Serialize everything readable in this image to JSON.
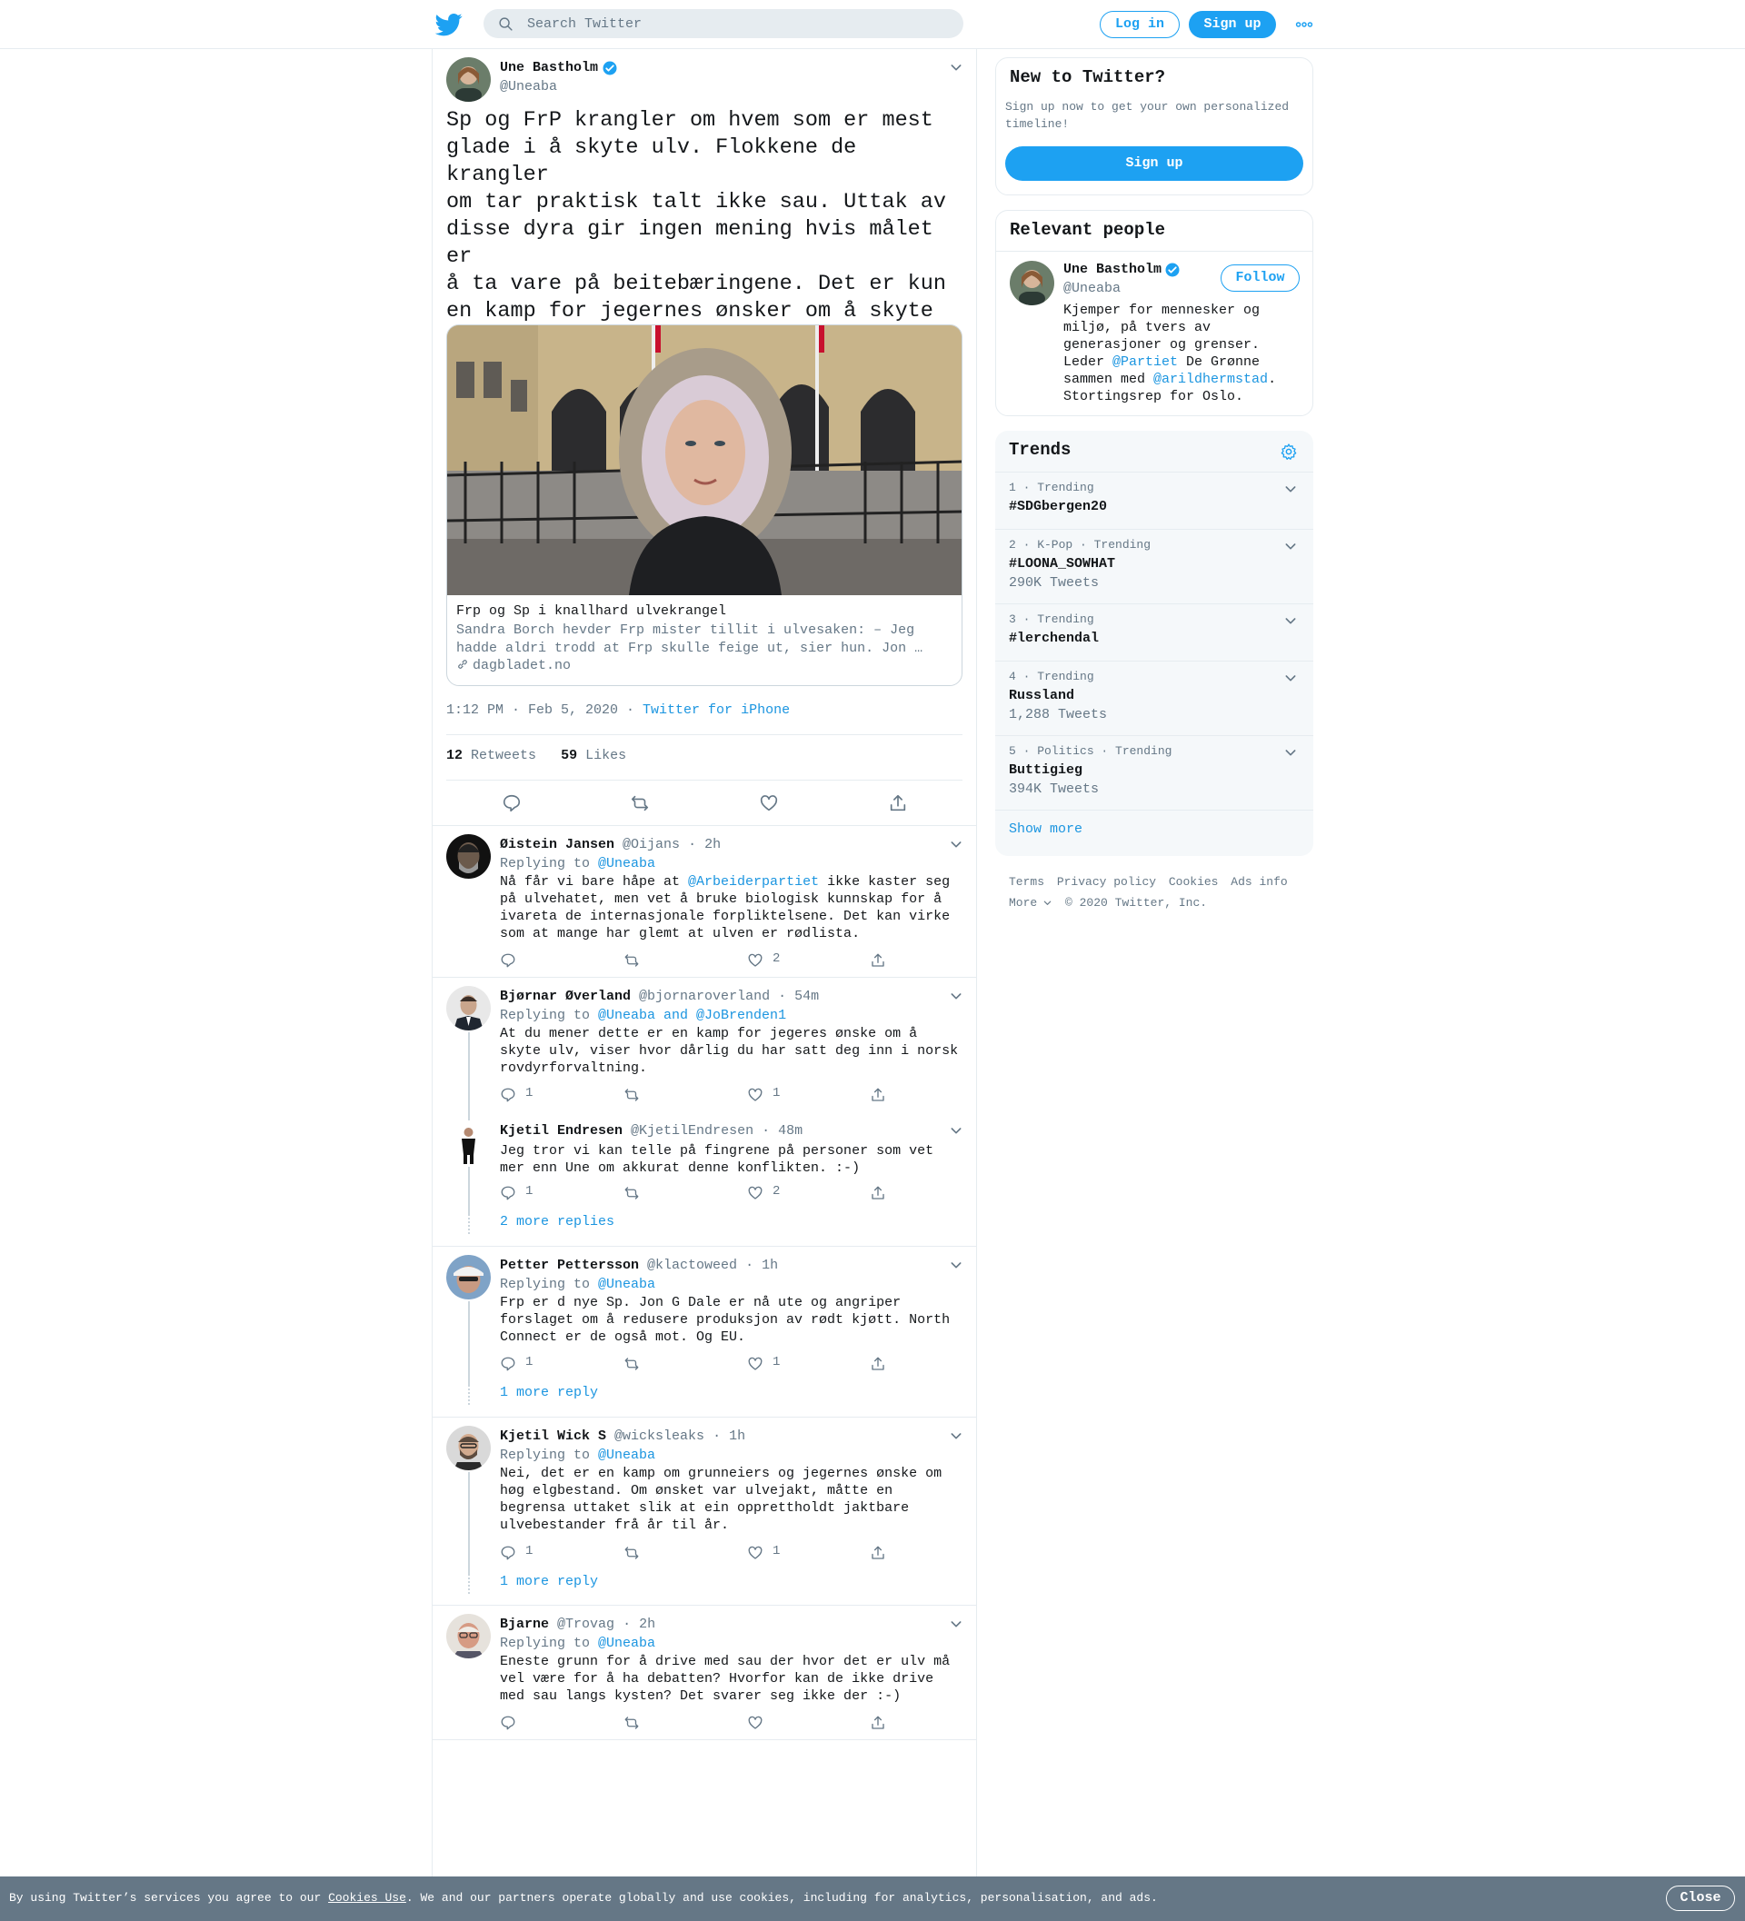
{
  "header": {
    "search_placeholder": "Search Twitter",
    "login_label": "Log in",
    "signup_label": "Sign up",
    "brand_color": "#1da1f2"
  },
  "main_tweet": {
    "name": "Une Bastholm",
    "handle": "@Uneaba",
    "verified": true,
    "text": "Sp og FrP krangler om hvem som er mest\nglade i å skyte ulv. Flokkene de krangler\nom tar praktisk talt ikke sau. Uttak av\ndisse dyra gir ingen mening hvis målet er\nå ta vare på beitebæringene. Det er kun\nen kamp for jegernes ønsker om å skyte\nstore rovdyr.",
    "card": {
      "title": "Frp og Sp i knallhard ulvekrangel",
      "description": "Sandra Borch hevder Frp mister tillit i ulvesaken: – Jeg hadde aldri trodd at Frp skulle feige ut, sier hun. Jon …",
      "domain": "dagbladet.no"
    },
    "time": "1:12 PM · Feb 5, 2020",
    "meta_sep": " · ",
    "source": "Twitter for iPhone",
    "retweets_count": "12",
    "retweets_label": "Retweets",
    "likes_count": "59",
    "likes_label": "Likes"
  },
  "replies": [
    {
      "name": "Øistein Jansen",
      "handle": "@Oijans",
      "age": "· 2h",
      "replying_prefix": "Replying to ",
      "replying_to": "@Uneaba",
      "text_pre": "Nå får vi bare håpe at ",
      "text_link": "@Arbeiderpartiet",
      "text_post": " ikke kaster seg på ulvehatet, men vet å bruke biologisk kunnskap for å ivareta de internasjonale forpliktelsene. Det kan virke som at mange har glemt at ulven er rødlista.",
      "reply_count": "",
      "like_count": "2"
    },
    {
      "name": "Bjørnar Øverland",
      "handle": "@bjornaroverland",
      "age": "· 54m",
      "replying_prefix": "Replying to ",
      "replying_to": "@Uneaba and @JoBrenden1",
      "text": "At du mener dette er en kamp for jegeres ønske om å skyte ulv, viser hvor dårlig du har satt deg inn i norsk rovdyrforvaltning.",
      "reply_count": "1",
      "like_count": "1"
    },
    {
      "name": "Kjetil Endresen",
      "handle": "@KjetilEndresen",
      "age": "· 48m",
      "text": "Jeg tror vi kan telle på fingrene på personer som vet mer enn Une om akkurat denne konflikten. :-)",
      "reply_count": "1",
      "like_count": "2",
      "more_replies": "2 more replies"
    },
    {
      "name": "Petter Pettersson",
      "handle": "@klactoweed",
      "age": "· 1h",
      "replying_prefix": "Replying to ",
      "replying_to": "@Uneaba",
      "text": "Frp er d nye Sp. Jon G Dale er nå ute og angriper forslaget om å redusere produksjon av rødt kjøtt. North Connect er de også mot. Og EU.",
      "reply_count": "1",
      "like_count": "1",
      "more_replies": "1 more reply"
    },
    {
      "name": "Kjetil Wick S",
      "handle": "@wicksleaks",
      "age": "· 1h",
      "replying_prefix": "Replying to ",
      "replying_to": "@Uneaba",
      "text": "Nei, det er en kamp om grunneiers og jegernes ønske om høg elgbestand. Om ønsket var ulvejakt, måtte en begrensa uttaket slik at ein opprettholdt jaktbare ulvebestander frå år til år.",
      "reply_count": "1",
      "like_count": "1",
      "more_replies": "1 more reply"
    },
    {
      "name": "Bjarne",
      "handle": "@Trovag",
      "age": "· 2h",
      "replying_prefix": "Replying to ",
      "replying_to": "@Uneaba",
      "text": "Eneste grunn for å drive med sau der hvor det er ulv må vel være for å ha debatten? Hvorfor kan de ikke drive med sau langs kysten? Det svarer seg ikke der :-)",
      "reply_count": "",
      "like_count": ""
    }
  ],
  "sidebar": {
    "new_to_twitter": {
      "title": "New to Twitter?",
      "subtitle": "Sign up now to get your own personalized timeline!",
      "signup_label": "Sign up"
    },
    "relevant_people": {
      "title": "Relevant people",
      "name": "Une Bastholm",
      "handle": "@Uneaba",
      "follow_label": "Follow",
      "bio_1": "Kjemper for mennesker og miljø, på tvers av generasjoner og grenser. Leder ",
      "bio_link_1": "@Partiet",
      "bio_2": " De Grønne sammen med ",
      "bio_link_2": "@arildhermstad",
      "bio_3": ". Stortingsrep for Oslo."
    },
    "trends": {
      "title": "Trends",
      "items": [
        {
          "meta": "1 · Trending",
          "name": "#SDGbergen20",
          "count": ""
        },
        {
          "meta": "2 · K-Pop · Trending",
          "name": "#LOONA_SOWHAT",
          "count": "290K Tweets"
        },
        {
          "meta": "3 · Trending",
          "name": "#lerchendal",
          "count": ""
        },
        {
          "meta": "4 · Trending",
          "name": "Russland",
          "count": "1,288 Tweets"
        },
        {
          "meta": "5 · Politics · Trending",
          "name": "Buttigieg",
          "count": "394K Tweets"
        }
      ],
      "show_more": "Show more"
    },
    "footer": {
      "terms": "Terms",
      "privacy": "Privacy policy",
      "cookies": "Cookies",
      "ads": "Ads info",
      "more": "More",
      "copyright": "© 2020 Twitter, Inc."
    }
  },
  "cookie_bar": {
    "text_pre": "By using Twitter’s services you agree to our ",
    "link": "Cookies Use",
    "text_post": ". We and our partners operate globally and use cookies, including for analytics, personalisation, and ads.",
    "close_label": "Close"
  }
}
